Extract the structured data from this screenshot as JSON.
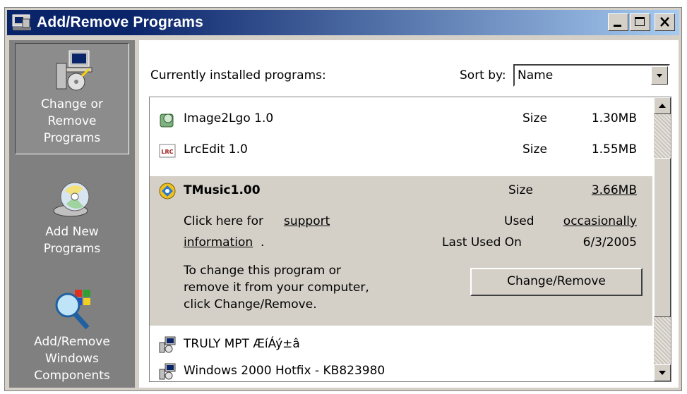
{
  "window": {
    "title": "Add/Remove Programs",
    "controls": {
      "minimize": "minimize",
      "maximize": "maximize",
      "close": "close"
    }
  },
  "sidebar": {
    "items": [
      {
        "label": "Change or Remove Programs",
        "icon": "change-remove-programs-icon",
        "active": true
      },
      {
        "label": "Add New Programs",
        "icon": "cd-disk-icon",
        "active": false
      },
      {
        "label": "Add/Remove Windows Components",
        "icon": "windows-components-icon",
        "active": false
      }
    ]
  },
  "main": {
    "header_label": "Currently installed programs:",
    "sort_label": "Sort by:",
    "sort_value": "Name"
  },
  "programs": [
    {
      "name": "Image2Lgo 1.0",
      "icon": "installer-icon",
      "size_label": "Size",
      "size": "1.30MB"
    },
    {
      "name": "LrcEdit 1.0",
      "icon": "lrc-icon",
      "size_label": "Size",
      "size": "1.55MB"
    },
    {
      "name": "TMusic1.00",
      "icon": "tmusic-icon",
      "size_label": "Size",
      "size": "3.66MB"
    },
    {
      "name": "TRULY MPT ÆíÁý±â",
      "icon": "setup-icon"
    },
    {
      "name": "Windows 2000 Hotfix - KB823980",
      "icon": "setup-icon"
    }
  ],
  "selected": {
    "support_prefix": "Click here for",
    "support_link_1": "support",
    "support_link_2": "information",
    "support_suffix": ".",
    "used_label": "Used",
    "used_value": "occasionally",
    "last_used_label": "Last Used On",
    "last_used_value": "6/3/2005",
    "change_text_1": "To change this program or",
    "change_text_2": "remove it from your computer,",
    "change_text_3": "click Change/Remove.",
    "change_button": "Change/Remove"
  },
  "colors": {
    "titlebar_start": "#0a246a",
    "titlebar_end": "#a6caf0",
    "sidebar": "#808080",
    "face": "#d4d0c8"
  }
}
